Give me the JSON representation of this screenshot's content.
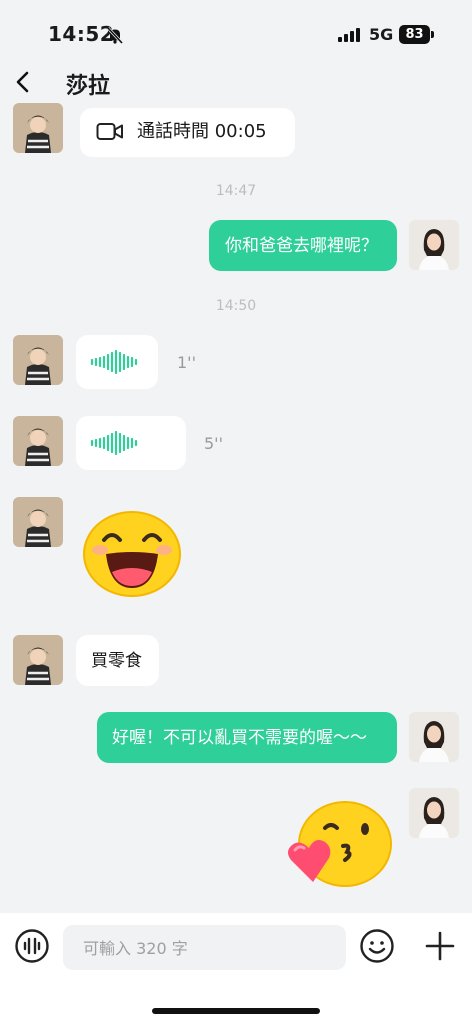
{
  "status_bar": {
    "time": "14:52",
    "network": "5G",
    "battery": "83"
  },
  "header": {
    "title": "莎拉"
  },
  "messages": [
    {
      "type": "call",
      "text": "通話時間 00:05"
    },
    {
      "type": "timestamp",
      "text": "14:47"
    },
    {
      "type": "text_out",
      "text": "你和爸爸去哪裡呢？"
    },
    {
      "type": "timestamp",
      "text": "14:50"
    },
    {
      "type": "voice_in",
      "duration": "1''"
    },
    {
      "type": "voice_in",
      "duration": "5''"
    },
    {
      "type": "sticker_in",
      "icon": "laughing-face-sticker"
    },
    {
      "type": "text_in",
      "text": "買零食"
    },
    {
      "type": "text_out",
      "text": "好喔！不可以亂買不需要的喔～～"
    },
    {
      "type": "sticker_out",
      "icon": "kissing-heart-face-sticker"
    }
  ],
  "input": {
    "placeholder": "可輸入 320 字"
  },
  "colors": {
    "accent": "#2ecf98",
    "background": "#f2f3f5"
  }
}
